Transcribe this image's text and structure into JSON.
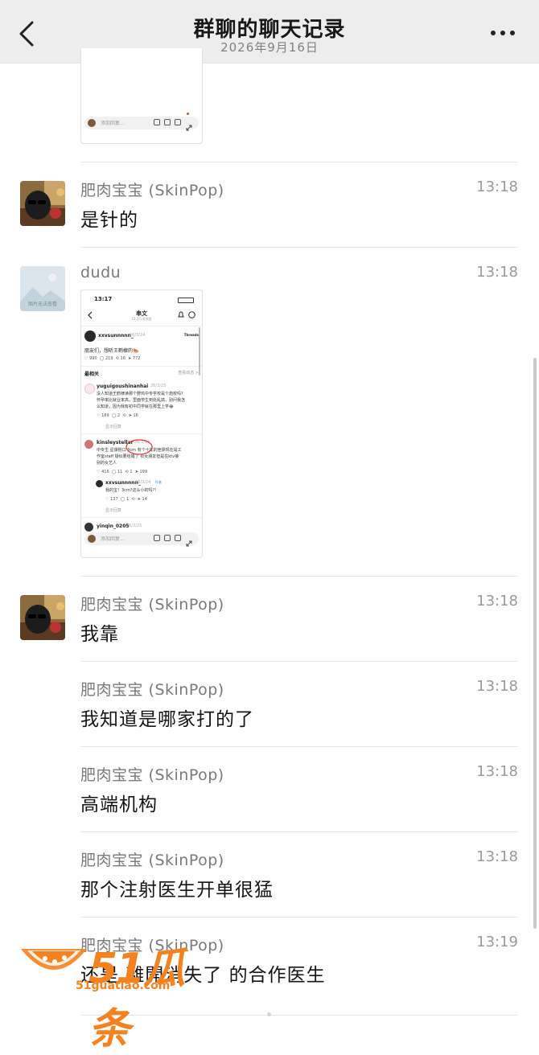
{
  "header": {
    "title": "群聊的聊天记录",
    "subtitle": "2026年9月16日"
  },
  "top_card": {
    "reply_placeholder": "添加回复..."
  },
  "messages": [
    {
      "sender": "肥肉宝宝 (SkinPop)",
      "time": "13:18",
      "text": "是针的"
    },
    {
      "sender": "dudu",
      "time": "13:18"
    },
    {
      "sender": "肥肉宝宝 (SkinPop)",
      "time": "13:18",
      "text": "我靠"
    },
    {
      "sender": "肥肉宝宝 (SkinPop)",
      "time": "13:18",
      "text": "我知道是哪家打的了"
    },
    {
      "sender": "肥肉宝宝 (SkinPop)",
      "time": "13:18",
      "text": "高端机构"
    },
    {
      "sender": "肥肉宝宝 (SkinPop)",
      "time": "13:18",
      "text": "那个注射医生开单很猛"
    },
    {
      "sender": "肥肉宝宝 (SkinPop)",
      "time": "13:19",
      "text": "还是 離開消失了 的合作医生"
    }
  ],
  "dudu_avatar_text": "图片无法查看",
  "threads_shot": {
    "status_time": "13:17",
    "title": "串文",
    "subtitle": "21.3万次浏览",
    "post_user": "xxvsunnnnn_",
    "post_date": "26/3/24",
    "app_name": "Threads",
    "post_text": "朋友们，想听王鹤棣的🍉",
    "post_stats": [
      "990",
      "219",
      "16",
      "772"
    ],
    "sort_label": "最相关",
    "sort_link": "查看动态 >",
    "reply1_user": "yuguigoushinanhai",
    "reply1_date": "26/3/25",
    "reply1_lines": [
      "没人知道王鹤棣读那个野鸡中专学校是个炮校吗?",
      "怀孕率比就业率高，里面学生到处乱搞，别问我怎",
      "么知道，因为我有初中同学就在那里上学😂"
    ],
    "reply1_stats": [
      "189",
      "2",
      "16"
    ],
    "reply1_more": "显示回复",
    "reply2_user": "kinsleystellar",
    "reply2_date": "26/3/24",
    "reply2_lines": [
      "中专生 星爆棍口 3cm 有个十年的挫嫖现在是工",
      "作室staff 疑似要结婚了 有女朋友但是在ktv接",
      "别的女艺人"
    ],
    "reply2_stats": [
      "416",
      "11",
      "1",
      "199"
    ],
    "sub_user": "xxvsunnnnn_",
    "sub_date": "26/3/24",
    "sub_tag": "作者",
    "sub_text": "我的宝！3cm?这么小的吗?!",
    "sub_stats": [
      "137",
      "1",
      "14"
    ],
    "sub_more": "显示回复",
    "reply3_user": "yinqin_0205",
    "reply3_date": "26/3/25",
    "reply_placeholder": "添加回复..."
  },
  "watermark": {
    "logo": "51瓜条",
    "url": "51guatiao.com"
  }
}
